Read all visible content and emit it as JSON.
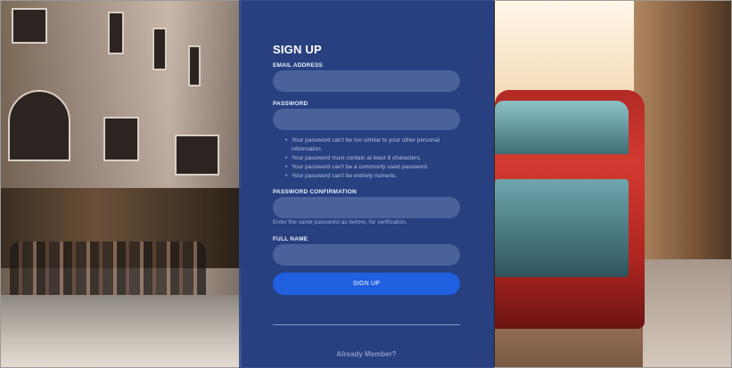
{
  "form": {
    "title": "SIGN UP",
    "email_label": "EMAIL ADDRESS",
    "email_value": "",
    "password_label": "PASSWORD",
    "password_value": "",
    "password_hints": [
      "Your password can't be too similar to your other personal information.",
      "Your password must contain at least 8 characters.",
      "Your password can't be a commonly used password.",
      "Your password can't be entirely numeric."
    ],
    "confirm_label": "PASSWORD CONFIRMATION",
    "confirm_value": "",
    "confirm_help": "Enter the same password as before, for verification.",
    "fullname_label": "FULL NAME",
    "fullname_value": "",
    "submit_label": "SIGN UP",
    "member_link": "Already Member?"
  },
  "colors": {
    "panel": "#28448c",
    "button": "#1f5fe0"
  }
}
